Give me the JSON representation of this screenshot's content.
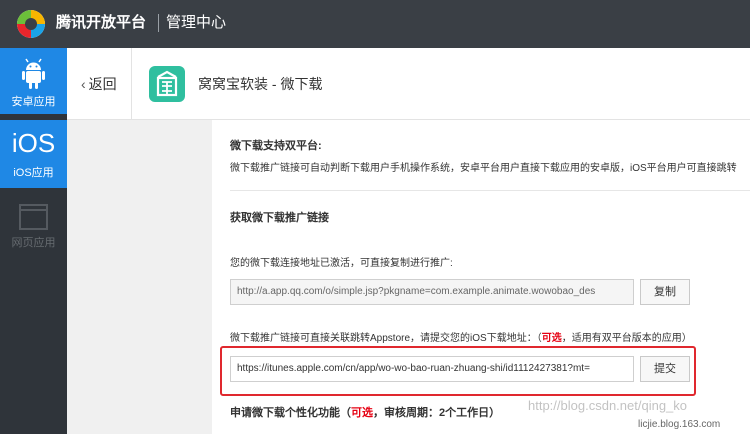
{
  "header": {
    "brand": "腾讯开放平台",
    "console": "管理中心"
  },
  "sidebar": {
    "items": [
      {
        "label": "安卓应用",
        "icon": "android-icon"
      },
      {
        "label": "iOS应用",
        "icon_text": "iOS"
      },
      {
        "label": "网页应用",
        "icon": "browser-window-icon"
      }
    ]
  },
  "subheader": {
    "back_label": "返回",
    "app_title": "窝窝宝软装  -  微下载",
    "app_icon_char": "窝"
  },
  "content": {
    "section1_title": "微下载支持双平台:",
    "section1_desc": "微下载推广链接可自动判断下载用户手机操作系统，安卓平台用户直接下载应用的安卓版，iOS平台用户可直接跳转",
    "section2_title": "获取微下载推广链接",
    "activated_text": "您的微下载连接地址已激活，可直接复制进行推广:",
    "link_url": "http://a.app.qq.com/o/simple.jsp?pkgname=com.example.animate.wowobao_des",
    "copy_button": "复制",
    "appstore_prefix": "微下载推广链接可直接关联跳转Appstore，请提交您的iOS下载地址：（",
    "appstore_optional": "可选",
    "appstore_suffix": "，适用有双平台版本的应用）",
    "ios_url": "https://itunes.apple.com/cn/app/wo-wo-bao-ruan-zhuang-shi/id1112427381?mt=",
    "submit_button": "提交",
    "section3_prefix": "申请微下载个性化功能（",
    "section3_optional": "可选",
    "section3_suffix": "，审核周期：2个工作日）"
  },
  "watermark": "http://blog.csdn.net/qing_ko",
  "footer_mark": "licjie.blog.163.com",
  "colors": {
    "topbar": "#3a3f45",
    "sidebar": "#2f343a",
    "active_blue": "#1f88e5",
    "highlight_red": "#e0282e",
    "app_green": "#2fbf9f"
  }
}
